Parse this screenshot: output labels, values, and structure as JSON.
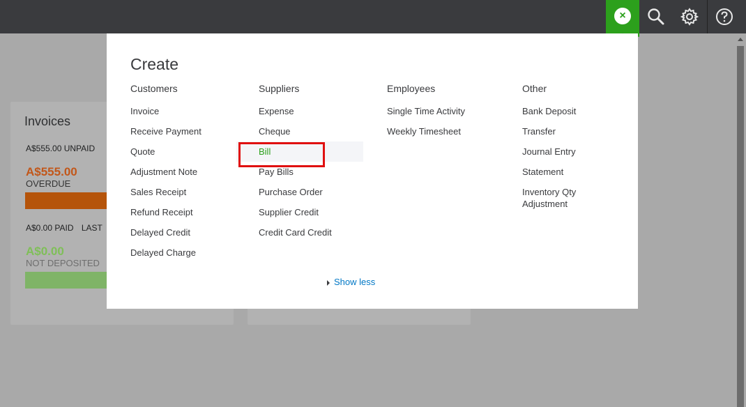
{
  "topbar": {
    "close_glyph": "×",
    "icons": [
      "close-icon",
      "search-icon",
      "gear-icon",
      "help-icon"
    ],
    "accent_color": "#2ca01c"
  },
  "dashboard": {
    "invoices": {
      "title": "Invoices",
      "unpaid": "A$555.00 UNPAID",
      "overdue_amount": "A$555.00",
      "overdue_label": "OVERDUE",
      "paid": "A$0.00 PAID",
      "paid_suffix": "LAST",
      "not_deposited_amount": "A$0.00",
      "not_deposited_label": "NOT DEPOSITED"
    }
  },
  "create": {
    "title": "Create",
    "columns": {
      "customers": {
        "heading": "Customers",
        "items": [
          "Invoice",
          "Receive Payment",
          "Quote",
          "Adjustment Note",
          "Sales Receipt",
          "Refund Receipt",
          "Delayed Credit",
          "Delayed Charge"
        ]
      },
      "suppliers": {
        "heading": "Suppliers",
        "items": [
          "Expense",
          "Cheque",
          "Bill",
          "Pay Bills",
          "Purchase Order",
          "Supplier Credit",
          "Credit Card Credit"
        ]
      },
      "employees": {
        "heading": "Employees",
        "items": [
          "Single Time Activity",
          "Weekly Timesheet"
        ]
      },
      "other": {
        "heading": "Other",
        "items": [
          "Bank Deposit",
          "Transfer",
          "Journal Entry",
          "Statement",
          "Inventory Qty Adjustment"
        ]
      }
    },
    "show_less": "Show less"
  }
}
